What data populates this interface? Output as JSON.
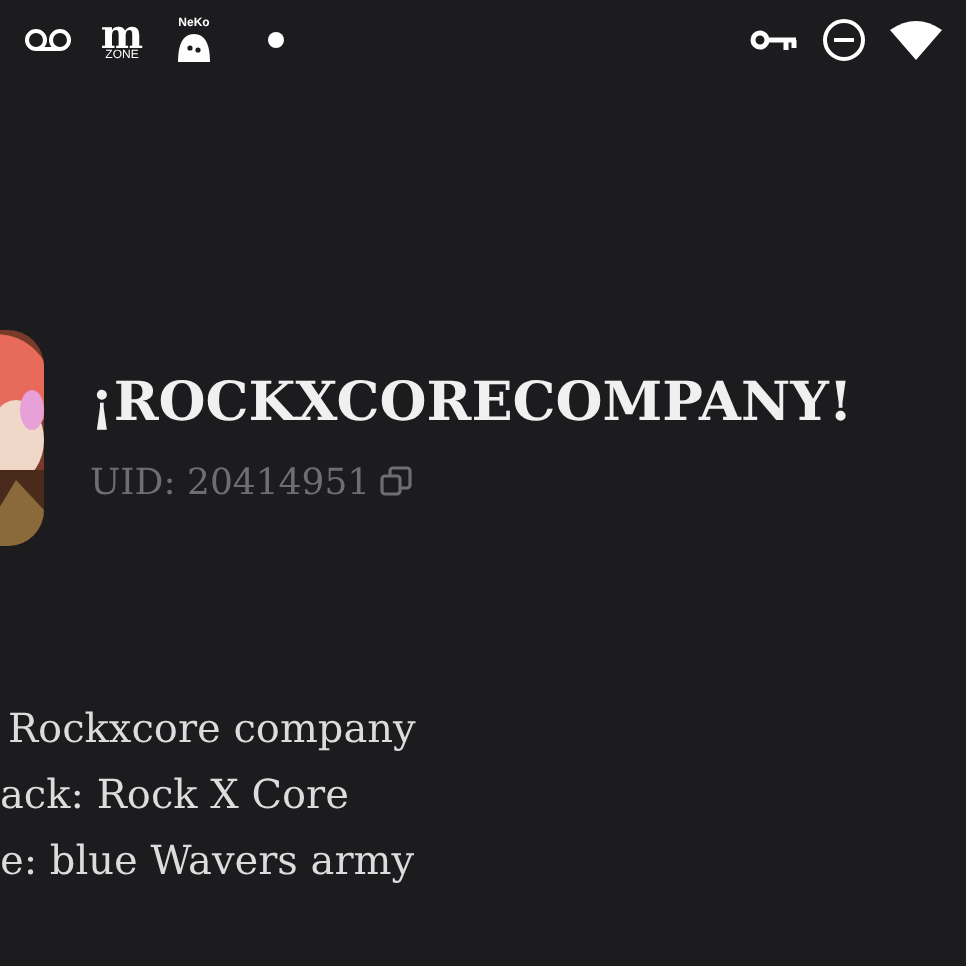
{
  "status_bar": {
    "app_icons": [
      {
        "kind": "voicemail"
      },
      {
        "kind": "mzone",
        "letter": "m",
        "caption": "ZONE"
      },
      {
        "kind": "neko",
        "caption": "NeKo"
      },
      {
        "kind": "dot"
      }
    ],
    "system_icons": [
      {
        "kind": "key"
      },
      {
        "kind": "dnd"
      },
      {
        "kind": "wifi"
      }
    ]
  },
  "profile": {
    "name": "¡ROCKXCORECOMPANY!",
    "uid": "UID: 20414951"
  },
  "bio_lines": [
    "Rockxcore company",
    "ack: Rock X Core",
    "e: blue Wavers army"
  ]
}
